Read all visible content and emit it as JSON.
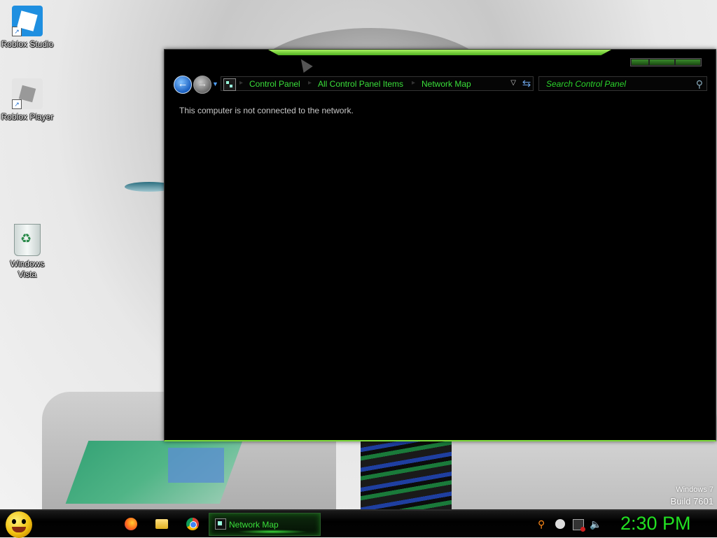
{
  "desktop": {
    "icons": [
      {
        "label": "Roblox Studio"
      },
      {
        "label": "Roblox Player"
      },
      {
        "label": "Windows Vista"
      }
    ],
    "watermark": {
      "line1": "Windows 7",
      "line2": "Build 7601"
    }
  },
  "window": {
    "breadcrumbs": [
      "Control Panel",
      "All Control Panel Items",
      "Network Map"
    ],
    "search_placeholder": "Search Control Panel",
    "message": "This computer is not connected to the network.",
    "accent_color": "#3adf3a"
  },
  "taskbar": {
    "pinned": [
      {
        "icon": "firefox-icon"
      },
      {
        "icon": "folder-icon"
      },
      {
        "icon": "chrome-icon"
      }
    ],
    "active_task": "Network Map",
    "clock": "2:30 PM",
    "tray_icons": [
      "search-icon",
      "message-icon",
      "network-icon",
      "volume-icon"
    ]
  }
}
